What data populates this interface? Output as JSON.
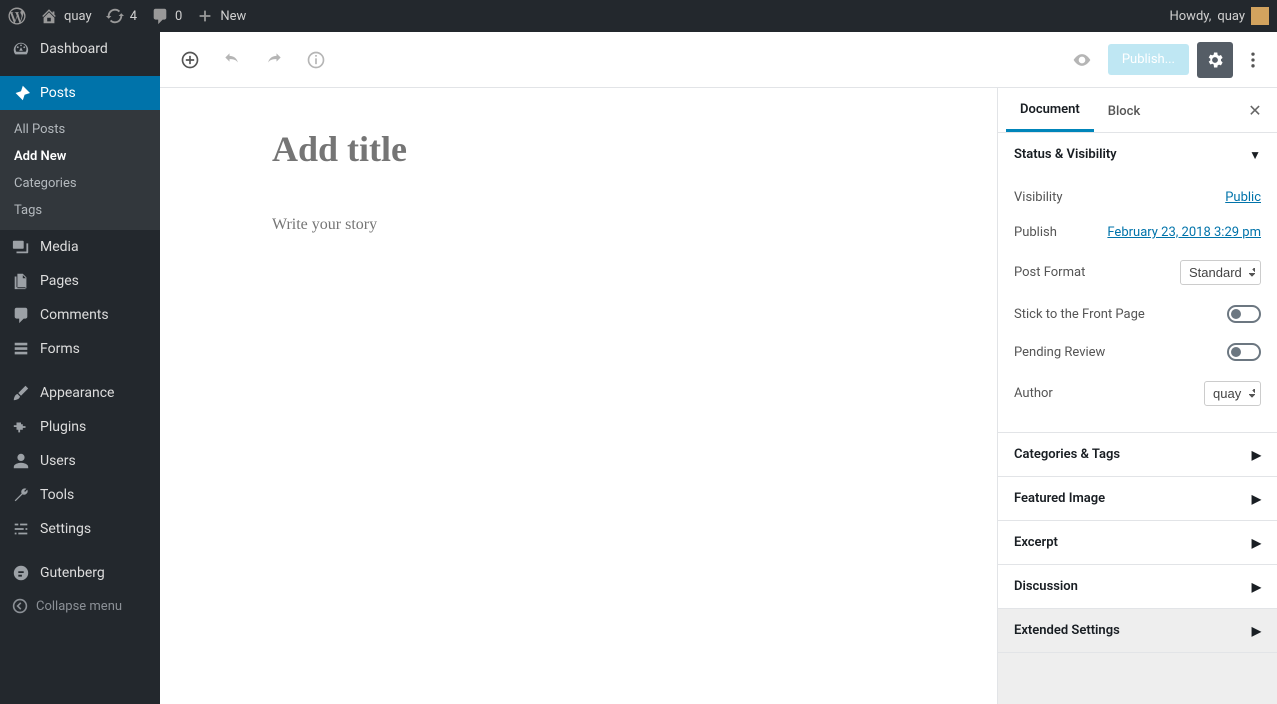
{
  "adminbar": {
    "site_name": "quay",
    "updates_count": "4",
    "comments_count": "0",
    "new_label": "New",
    "howdy_prefix": "Howdy, ",
    "user_name": "quay"
  },
  "sidebar": {
    "dashboard": "Dashboard",
    "posts": "Posts",
    "submenu": [
      "All Posts",
      "Add New",
      "Categories",
      "Tags"
    ],
    "media": "Media",
    "pages": "Pages",
    "comments": "Comments",
    "forms": "Forms",
    "appearance": "Appearance",
    "plugins": "Plugins",
    "users": "Users",
    "tools": "Tools",
    "settings": "Settings",
    "gutenberg": "Gutenberg",
    "collapse": "Collapse menu"
  },
  "editor": {
    "publish_label": "Publish...",
    "title_placeholder": "Add title",
    "story_placeholder": "Write your story"
  },
  "inspector": {
    "tabs": {
      "document": "Document",
      "block": "Block"
    },
    "status_visibility": "Status & Visibility",
    "visibility_label": "Visibility",
    "visibility_value": "Public",
    "publish_label": "Publish",
    "publish_value": "February 23, 2018 3:29 pm",
    "post_format_label": "Post Format",
    "post_format_value": "Standard",
    "stick_label": "Stick to the Front Page",
    "pending_label": "Pending Review",
    "author_label": "Author",
    "author_value": "quay",
    "panels": {
      "categories_tags": "Categories & Tags",
      "featured_image": "Featured Image",
      "excerpt": "Excerpt",
      "discussion": "Discussion",
      "extended": "Extended Settings"
    }
  }
}
